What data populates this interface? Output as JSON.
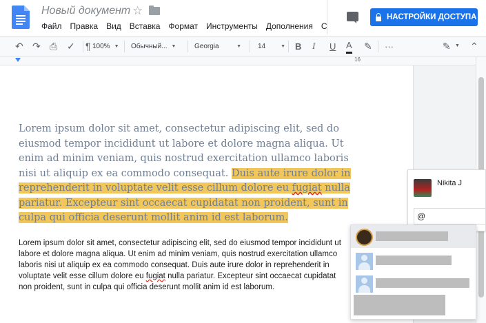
{
  "header": {
    "title": "Новый документ",
    "menu": [
      "Файл",
      "Правка",
      "Вид",
      "Вставка",
      "Формат",
      "Инструменты",
      "Дополнения",
      "С"
    ],
    "share_label": "НАСТРОЙКИ ДОСТУПА"
  },
  "toolbar": {
    "zoom": "100%",
    "style": "Обычный...",
    "font": "Georgia",
    "size": "14",
    "bold": "B",
    "italic": "I",
    "underline": "U",
    "text_color_label": "A",
    "more": "···"
  },
  "ruler": {
    "label": "16"
  },
  "document": {
    "para1_plain": "Lorem ipsum dolor sit amet, consectetur adipiscing elit, sed do eiusmod tempor incididunt ut labore et dolore magna aliqua. Ut enim ad minim veniam, quis nostrud exercitation ullamco laboris nisi ut aliquip ex ea commodo consequat. ",
    "para1_hl_a": "Duis aute irure dolor in reprehenderit in voluptate velit esse cillum dolore eu ",
    "para1_hl_spell": "fugiat",
    "para1_hl_b": " nulla pariatur. Excepteur sint occaecat cupidatat non proident, sunt in culpa qui officia deserunt mollit anim id est laborum.",
    "para2_a": "Lorem ipsum dolor sit amet, consectetur adipiscing elit, sed do eiusmod tempor incididunt ut labore et dolore magna aliqua. Ut enim ad minim veniam, quis nostrud exercitation ullamco laboris nisi ut aliquip ex ea commodo consequat. Duis aute irure dolor in reprehenderit in voluptate velit esse cillum dolore eu ",
    "para2_spell": "fugiat",
    "para2_b": " nulla pariatur. Excepteur sint occaecat cupidatat non proident, sunt in culpa qui officia deserunt mollit anim id est laborum."
  },
  "comment": {
    "author": "Nikita J",
    "input_value": "@"
  },
  "colors": {
    "accent": "#1a73e8",
    "highlight": "#f1c65b",
    "serif_text": "#6f7f96"
  }
}
